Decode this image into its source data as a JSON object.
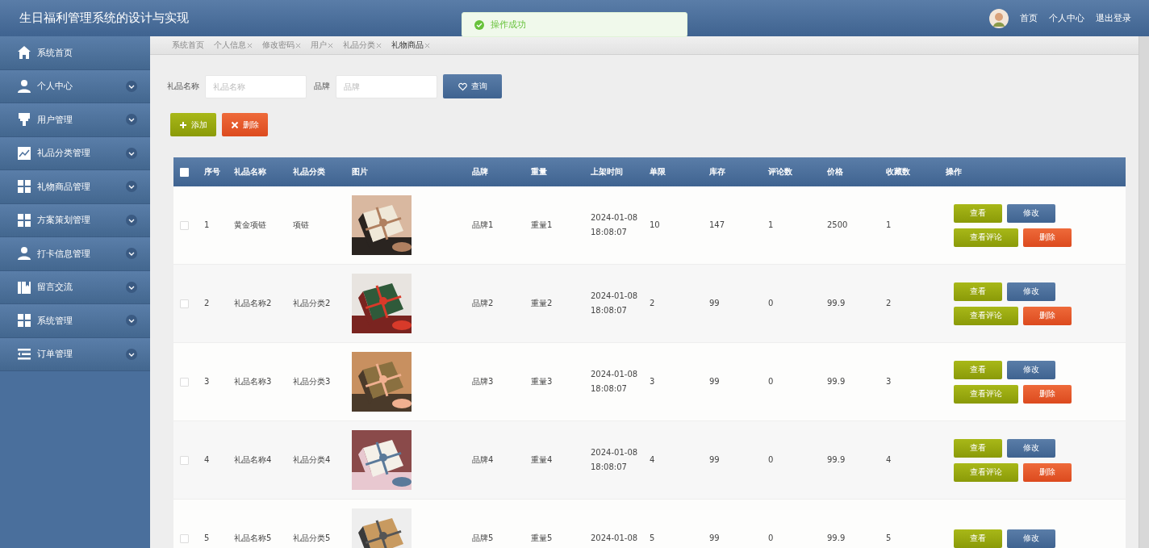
{
  "header": {
    "title": "生日福利管理系统的设计与实现",
    "links": [
      "首页",
      "个人中心",
      "退出登录"
    ]
  },
  "toast": {
    "text": "操作成功"
  },
  "sidebar": {
    "items": [
      {
        "label": "系统首页",
        "expandable": false
      },
      {
        "label": "个人中心",
        "expandable": true
      },
      {
        "label": "用户管理",
        "expandable": true
      },
      {
        "label": "礼品分类管理",
        "expandable": true
      },
      {
        "label": "礼物商品管理",
        "expandable": true
      },
      {
        "label": "方案策划管理",
        "expandable": true
      },
      {
        "label": "打卡信息管理",
        "expandable": true
      },
      {
        "label": "留言交流",
        "expandable": true
      },
      {
        "label": "系统管理",
        "expandable": true
      },
      {
        "label": "订单管理",
        "expandable": true
      }
    ]
  },
  "tabs": [
    {
      "label": "系统首页",
      "closable": false,
      "selected": false
    },
    {
      "label": "个人信息",
      "closable": true,
      "selected": false
    },
    {
      "label": "修改密码",
      "closable": true,
      "selected": false
    },
    {
      "label": "用户",
      "closable": true,
      "selected": false
    },
    {
      "label": "礼品分类",
      "closable": true,
      "selected": false
    },
    {
      "label": "礼物商品",
      "closable": true,
      "selected": true
    }
  ],
  "search": {
    "fields": [
      {
        "label": "礼品名称",
        "placeholder": "礼品名称"
      },
      {
        "label": "品牌",
        "placeholder": "品牌"
      }
    ],
    "button": "查询"
  },
  "toolbar": [
    {
      "label": "添加",
      "kind": "add"
    },
    {
      "label": "删除",
      "kind": "delete"
    }
  ],
  "table": {
    "all_checked": false,
    "columns": [
      "序号",
      "礼品名称",
      "礼品分类",
      "图片",
      "品牌",
      "重量",
      "上架时间",
      "单限",
      "库存",
      "评论数",
      "价格",
      "收藏数",
      "操作"
    ],
    "rows": [
      {
        "checked": false,
        "cells": [
          "1",
          "黄金项链",
          "项链"
        ],
        "image": {
          "kind": "picture"
        },
        "rest": [
          "品牌1",
          "重量1",
          "2024-01-08 18:08:07",
          "10",
          "147",
          "1",
          "2500",
          "1"
        ],
        "actions": [
          {
            "label": "查看",
            "kind": "view"
          },
          {
            "label": "修改",
            "kind": "edit"
          },
          {
            "label": "查看评论",
            "kind": "view"
          },
          {
            "label": "删除",
            "kind": "delete"
          }
        ]
      },
      {
        "checked": false,
        "cells": [
          "2",
          "礼品名称2",
          "礼品分类2"
        ],
        "image": {
          "kind": "picture"
        },
        "rest": [
          "品牌2",
          "重量2",
          "2024-01-08 18:08:07",
          "2",
          "99",
          "0",
          "99.9",
          "2"
        ],
        "actions": [
          {
            "label": "查看",
            "kind": "view"
          },
          {
            "label": "修改",
            "kind": "edit"
          },
          {
            "label": "查看评论",
            "kind": "view"
          },
          {
            "label": "删除",
            "kind": "delete"
          }
        ]
      },
      {
        "checked": false,
        "cells": [
          "3",
          "礼品名称3",
          "礼品分类3"
        ],
        "image": {
          "kind": "picture"
        },
        "rest": [
          "品牌3",
          "重量3",
          "2024-01-08 18:08:07",
          "3",
          "99",
          "0",
          "99.9",
          "3"
        ],
        "actions": [
          {
            "label": "查看",
            "kind": "view"
          },
          {
            "label": "修改",
            "kind": "edit"
          },
          {
            "label": "查看评论",
            "kind": "view"
          },
          {
            "label": "删除",
            "kind": "delete"
          }
        ]
      },
      {
        "checked": false,
        "cells": [
          "4",
          "礼品名称4",
          "礼品分类4"
        ],
        "image": {
          "kind": "picture"
        },
        "rest": [
          "品牌4",
          "重量4",
          "2024-01-08 18:08:07",
          "4",
          "99",
          "0",
          "99.9",
          "4"
        ],
        "actions": [
          {
            "label": "查看",
            "kind": "view"
          },
          {
            "label": "修改",
            "kind": "edit"
          },
          {
            "label": "查看评论",
            "kind": "view"
          },
          {
            "label": "删除",
            "kind": "delete"
          }
        ]
      },
      {
        "checked": false,
        "cells": [
          "5",
          "礼品名称5",
          "礼品分类5"
        ],
        "image": {
          "kind": "picture"
        },
        "rest": [
          "品牌5",
          "重量5",
          "2024-01-08",
          "5",
          "99",
          "0",
          "99.9",
          "5"
        ],
        "actions": [
          {
            "label": "查看",
            "kind": "view"
          },
          {
            "label": "修改",
            "kind": "edit"
          }
        ]
      }
    ]
  }
}
